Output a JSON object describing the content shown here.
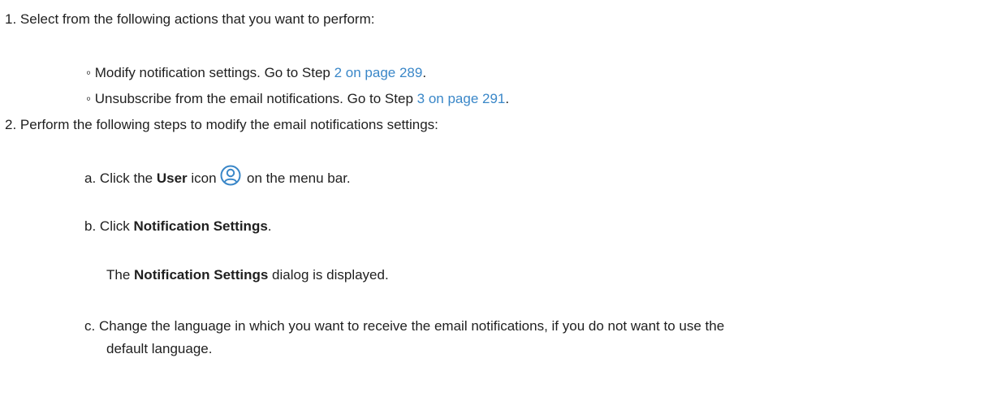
{
  "steps": {
    "step1": {
      "number": "1.",
      "text": "Select from the following actions that you want to perform:",
      "options": [
        {
          "bullet": "◦",
          "text_before": "Modify notification settings. Go to Step",
          "link": "2 on page 289",
          "text_after": "."
        },
        {
          "bullet": "◦",
          "text_before": "Unsubscribe from the email notifications. Go to Step",
          "link": "3 on page 291",
          "text_after": "."
        }
      ]
    },
    "step2": {
      "number": "2.",
      "text": "Perform the following steps to modify the email notifications settings:",
      "substeps": {
        "a": {
          "letter": "a.",
          "text_before": "Click the",
          "bold": "User",
          "text_mid": "icon",
          "text_after": "on the menu bar.",
          "icon": "user-icon"
        },
        "b": {
          "letter": "b.",
          "text_before": "Click",
          "bold": "Notification Settings",
          "text_after": "."
        },
        "b_result": {
          "text_before": "The",
          "bold": "Notification Settings",
          "text_after": "dialog is displayed."
        },
        "c": {
          "letter": "c.",
          "line1": "Change the language in which you want to receive the email notifications, if you do not want to use the",
          "line2": "default language."
        }
      }
    }
  },
  "colors": {
    "text": "#1f1f1f",
    "link": "#3a87c8",
    "icon": "#3a87c8"
  }
}
